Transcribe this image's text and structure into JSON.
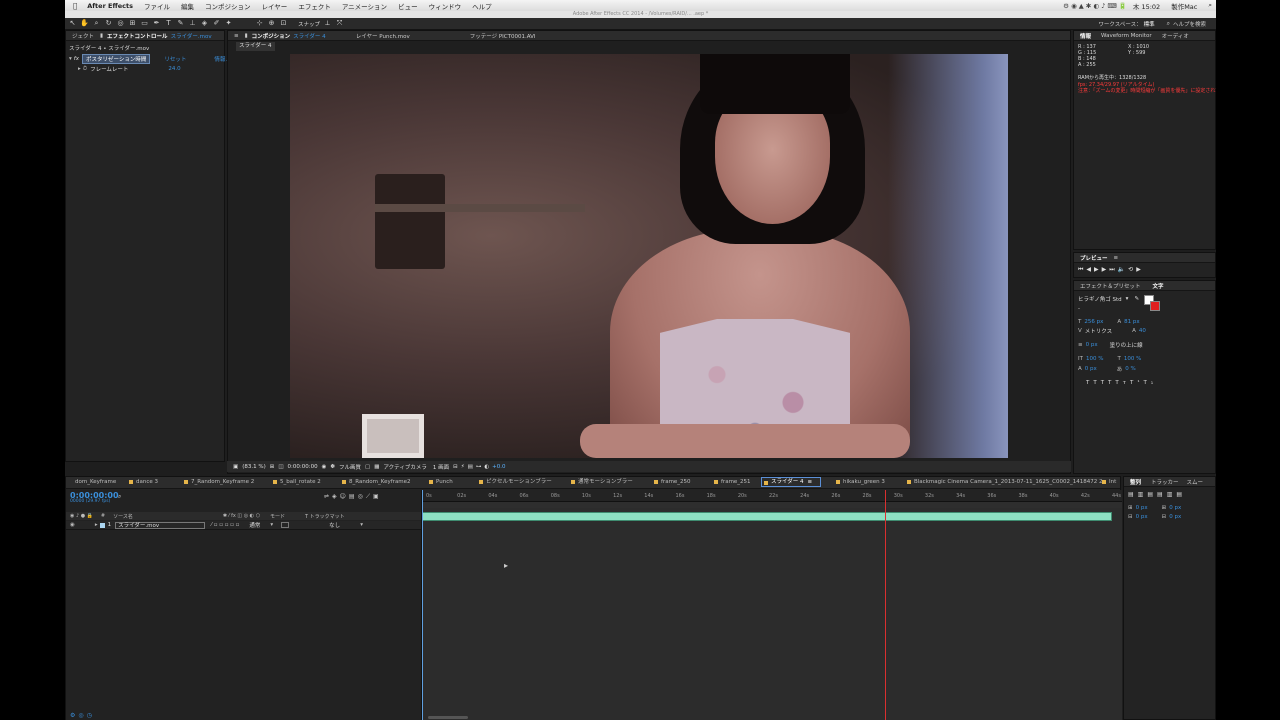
{
  "menubar": {
    "items": [
      "After Effects",
      "ファイル",
      "編集",
      "コンポジション",
      "レイヤー",
      "エフェクト",
      "アニメーション",
      "ビュー",
      "ウィンドウ",
      "ヘルプ"
    ],
    "right_clock": "木 15:02",
    "right_user": "製作Mac"
  },
  "title_bar": "Adobe After Effects CC 2014 - /Volumes/RAID/... .aep *",
  "workspace": {
    "label": "ワークスペース：",
    "value": "標準",
    "help_search": "ヘルプを検索"
  },
  "toolbar": {
    "snap": "スナップ"
  },
  "effect_controls": {
    "tab_left": "ジェクト",
    "tab_title": "エフェクトコントロール",
    "tab_target": "スライダー.mov",
    "breadcrumb": "スライダー 4 • スライダー.mov",
    "fx_name": "ポスタリゼーション時間",
    "fx_reset": "リセット",
    "fx_about": "情報...",
    "param_name": "フレームレート",
    "param_value": "24.0"
  },
  "viewer": {
    "tabs": [
      {
        "label": "コンポジション",
        "target": "スライダー 4",
        "active": true
      },
      {
        "label": "レイヤー Punch.mov",
        "active": false
      },
      {
        "label": "フッテージ PICT0001.AVI",
        "active": false
      }
    ],
    "sub_tab": "スライダー 4",
    "footer": {
      "zoom": "(83.1 %)",
      "timecode": "0:00:00:00",
      "resolution": "フル画質",
      "camera": "アクティブカメラ",
      "views": "1 画面",
      "exposure": "+0.0"
    }
  },
  "info_panel": {
    "tabs": [
      "情報",
      "Waveform Monitor",
      "オーディオ"
    ],
    "r": "R : 137",
    "g": "G : 115",
    "b": "B : 148",
    "a": "A : 255",
    "x": "X : 1010",
    "y": "Y : 599",
    "ram_preview": "RAMから再生中：1328/1328",
    "fps_warning": "fps: 27.34/29.97 (リアルタイム)",
    "note": "注意：「ズームの変更」時間短縮が「画質を優先」に設定されています"
  },
  "preview_panel": {
    "title": "プレビュー"
  },
  "character_panel": {
    "tabs": [
      "エフェクト＆プリセット",
      "文字"
    ],
    "font": "ヒラギノ角ゴ Std",
    "font_style": "-",
    "size": "256 px",
    "leading": "81 px",
    "tracking_label": "メトリクス",
    "tracking": "40",
    "stroke": "0 px",
    "stroke_type": "塗りの上に線",
    "vscale": "100 %",
    "hscale": "100 %",
    "baseline": "0 px",
    "tsume": "0 %",
    "colors": {
      "fill": "#ffffff",
      "stroke": "#e02020"
    }
  },
  "timeline": {
    "tabs": [
      {
        "label": "dom_Keyframe",
        "active": false
      },
      {
        "label": "dance 3",
        "active": false
      },
      {
        "label": "7_Random_Keyframe 2",
        "active": false
      },
      {
        "label": "5_ball_rotate 2",
        "active": false
      },
      {
        "label": "8_Random_Keyframe2",
        "active": false
      },
      {
        "label": "Punch",
        "active": false
      },
      {
        "label": "ピクセルモーションブラー",
        "active": false
      },
      {
        "label": "通常モーションブラー",
        "active": false
      },
      {
        "label": "frame_250",
        "active": false
      },
      {
        "label": "frame_251",
        "active": false
      },
      {
        "label": "スライダー 4",
        "active": true
      },
      {
        "label": "hikaku_green 3",
        "active": false
      },
      {
        "label": "Blackmagic Cinema Camera_1_2013-07-11_1625_C0002_1418472 2",
        "active": false
      },
      {
        "label": "Int",
        "active": false
      }
    ],
    "timecode": "0:00:00:00",
    "frame_info": "00000 (29.97 fps)",
    "columns": {
      "num": "#",
      "source": "ソース名",
      "mode": "モード",
      "trkmat": "T トラックマット"
    },
    "layer": {
      "index": "1",
      "name": "スライダー.mov",
      "mode": "通常",
      "trkmat": "なし"
    },
    "ruler": [
      "0s",
      "02s",
      "04s",
      "06s",
      "08s",
      "10s",
      "12s",
      "14s",
      "16s",
      "18s",
      "20s",
      "22s",
      "24s",
      "26s",
      "28s",
      "30s",
      "32s",
      "34s",
      "36s",
      "38s",
      "40s",
      "42s",
      "44s"
    ],
    "playhead_time": "29s",
    "colors": {
      "layer_bar": "#8de0c2",
      "playhead": "#d93030",
      "current_time": "#3a8fdb"
    }
  },
  "align_panel": {
    "tabs": [
      "整列",
      "トラッカー",
      "スムー"
    ],
    "values": [
      "0 px",
      "0 px",
      "0 px",
      "0 px"
    ]
  }
}
